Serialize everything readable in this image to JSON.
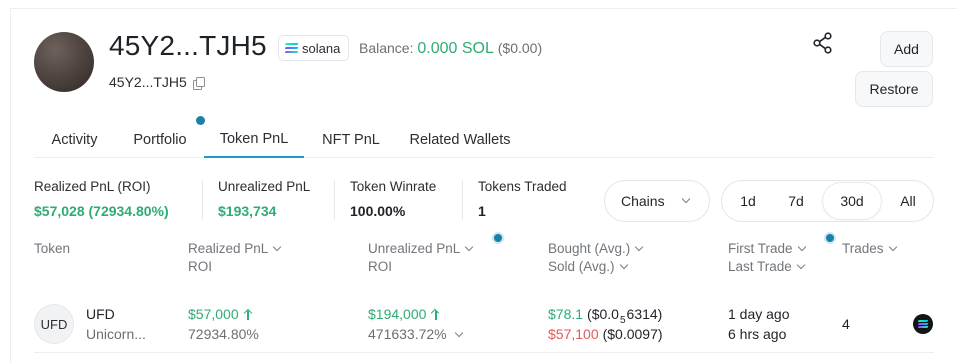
{
  "wallet": {
    "title": "45Y2...TJH5",
    "short_address": "45Y2...TJH5",
    "chain": "solana",
    "balance_label": "Balance:",
    "balance_value": "0.000 SOL",
    "balance_usd": "($0.00)"
  },
  "actions": {
    "add": "Add",
    "restore": "Restore"
  },
  "tabs": [
    {
      "label": "Activity"
    },
    {
      "label": "Portfolio"
    },
    {
      "label": "Token PnL",
      "active": true
    },
    {
      "label": "NFT PnL"
    },
    {
      "label": "Related Wallets"
    }
  ],
  "stats": {
    "realized": {
      "label": "Realized PnL (ROI)",
      "value": "$57,028 (72934.80%)"
    },
    "unrealized": {
      "label": "Unrealized PnL",
      "value": "$193,734"
    },
    "winrate": {
      "label": "Token Winrate",
      "value": "100.00%"
    },
    "traded": {
      "label": "Tokens Traded",
      "value": "1"
    }
  },
  "filters": {
    "chains_label": "Chains",
    "periods": [
      "1d",
      "7d",
      "30d",
      "All"
    ],
    "active_period": "30d"
  },
  "table": {
    "headers": {
      "token": "Token",
      "realized": "Realized PnL",
      "realized_sub": "ROI",
      "unrealized": "Unrealized PnL",
      "unrealized_sub": "ROI",
      "bought": "Bought (Avg.)",
      "sold": "Sold (Avg.)",
      "first_trade": "First Trade",
      "last_trade": "Last Trade",
      "trades": "Trades"
    },
    "rows": [
      {
        "logo_text": "UFD",
        "symbol": "UFD",
        "name": "Unicorn...",
        "realized": "$57,000",
        "realized_roi": "72934.80%",
        "unrealized": "$194,000",
        "unrealized_roi": "471633.72%",
        "bought": "$78.1",
        "bought_avg_prefix": "($0.0",
        "bought_avg_zeros": "5",
        "bought_avg_suffix": "6314)",
        "sold": "$57,100",
        "sold_avg": "($0.0097)",
        "first_trade": "1 day ago",
        "last_trade": "6 hrs ago",
        "trades": "4"
      }
    ]
  },
  "colors": {
    "positive": "#2eac74",
    "negative": "#e05a5a",
    "accent": "#1f9cc4",
    "solana_gradient": [
      "#9945ff",
      "#19fb9b"
    ]
  }
}
